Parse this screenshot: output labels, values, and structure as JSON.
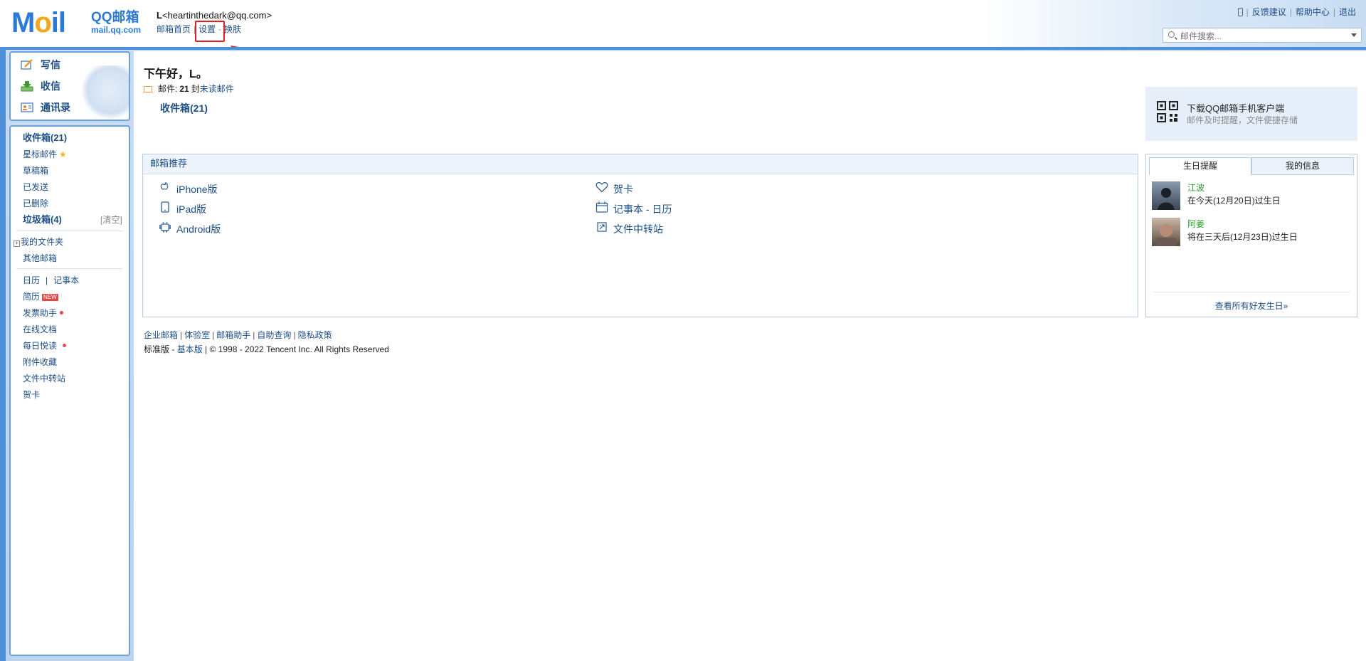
{
  "header": {
    "logo_brand": "QQ邮箱",
    "logo_domain": "mail.qq.com",
    "user_name": "L",
    "user_email": "<heartinthedark@qq.com>",
    "nav": [
      "邮箱首页",
      "设置",
      "换肤"
    ],
    "toplinks": [
      "反馈建议",
      "帮助中心",
      "退出"
    ],
    "search_placeholder": "邮件搜索..."
  },
  "quick_actions": [
    "写信",
    "收信",
    "通讯录"
  ],
  "folders": {
    "inbox": "收件箱(21)",
    "starred": "星标邮件",
    "drafts": "草稿箱",
    "sent": "已发送",
    "deleted": "已删除",
    "spam": "垃圾箱(4)",
    "spam_clear": "[清空]",
    "my_folders": "我的文件夹",
    "other_mail": "其他邮箱",
    "calendar": "日历",
    "calendar_sep": "|",
    "notes": "记事本",
    "resume": "简历",
    "resume_badge": "NEW",
    "invoice": "发票助手",
    "docs": "在线文档",
    "daily_read": "每日悦读",
    "attachments": "附件收藏",
    "transfer": "文件中转站",
    "cards": "贺卡"
  },
  "main": {
    "greeting": "下午好，L。",
    "mail_label": "邮件:",
    "mail_count": "21",
    "mail_unit": "封",
    "unread_link": "未读邮件",
    "inbox_link": "收件箱(21)"
  },
  "promo": {
    "title": "下载QQ邮箱手机客户端",
    "subtitle": "邮件及时提醒，文件便捷存储"
  },
  "recommend": {
    "header": "邮箱推荐",
    "items": [
      "iPhone版",
      "iPad版",
      "Android版",
      "贺卡",
      "记事本 - 日历",
      "文件中转站"
    ]
  },
  "birthday": {
    "tabs": [
      "生日提醒",
      "我的信息"
    ],
    "people": [
      {
        "name": "江波",
        "desc": "在今天(12月20日)过生日"
      },
      {
        "name": "阿姜",
        "desc": "将在三天后(12月23日)过生日"
      }
    ],
    "more": "查看所有好友生日»"
  },
  "footer": {
    "links": [
      "企业邮箱",
      "体验室",
      "邮箱助手",
      "自助查询",
      "隐私政策"
    ],
    "version": "标准版",
    "basic_link": "基本版",
    "copyright": "| © 1998 - 2022 Tencent Inc. All Rights Reserved"
  },
  "colors": {
    "frame_blue": "#4d8fd8",
    "link_blue": "#1d4f87",
    "highlight_red": "#e02020"
  }
}
